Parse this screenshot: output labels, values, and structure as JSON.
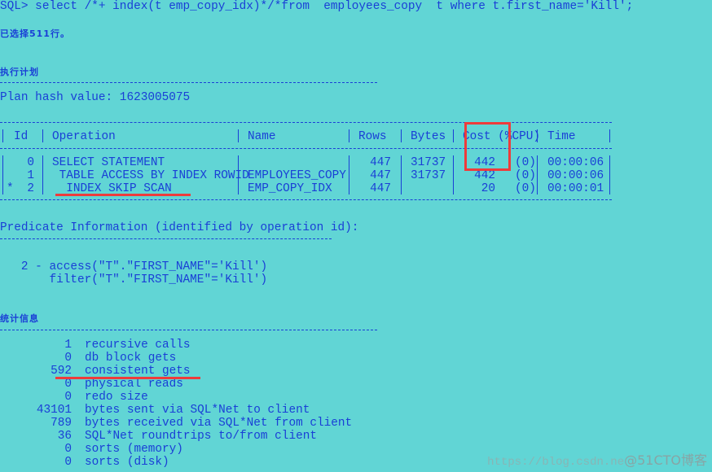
{
  "console": {
    "command_line": "SQL> select /*+ index(t emp_copy_idx)*/*from  employees_copy  t where t.first_name='Kill';",
    "rows_selected": "已选择511行。"
  },
  "execution_plan": {
    "heading": "执行计划",
    "plan_hash": "Plan hash value: 1623005075",
    "columns": [
      "Id",
      "Operation",
      "Name",
      "Rows",
      "Bytes",
      "Cost (%CPU)",
      "Time"
    ],
    "rows": [
      {
        "flag": "",
        "id": "0",
        "operation": "SELECT STATEMENT",
        "name": "",
        "rows": "447",
        "bytes": "31737",
        "cost": "442",
        "cpu": "(0)",
        "time": "00:00:06"
      },
      {
        "flag": "",
        "id": "1",
        "operation": " TABLE ACCESS BY INDEX ROWID",
        "name": "EMPLOYEES_COPY",
        "rows": "447",
        "bytes": "31737",
        "cost": "442",
        "cpu": "(0)",
        "time": "00:00:06"
      },
      {
        "flag": "*",
        "id": "2",
        "operation": "  INDEX SKIP SCAN",
        "name": "EMP_COPY_IDX",
        "rows": "447",
        "bytes": "",
        "cost": "20",
        "cpu": "(0)",
        "time": "00:00:01"
      }
    ]
  },
  "predicate": {
    "heading": "Predicate Information (identified by operation id):",
    "lines": [
      "   2 - access(\"T\".\"FIRST_NAME\"='Kill')",
      "       filter(\"T\".\"FIRST_NAME\"='Kill')"
    ]
  },
  "statistics": {
    "heading": "统计信息",
    "items": [
      {
        "value": "1",
        "label": "recursive calls"
      },
      {
        "value": "0",
        "label": "db block gets"
      },
      {
        "value": "592",
        "label": "consistent gets"
      },
      {
        "value": "0",
        "label": "physical reads"
      },
      {
        "value": "0",
        "label": "redo size"
      },
      {
        "value": "43101",
        "label": "bytes sent via SQL*Net to client"
      },
      {
        "value": "789",
        "label": "bytes received via SQL*Net from client"
      },
      {
        "value": "36",
        "label": "SQL*Net roundtrips to/from client"
      },
      {
        "value": "0",
        "label": "sorts (memory)"
      },
      {
        "value": "0",
        "label": "sorts (disk)"
      }
    ]
  },
  "annotations": {
    "highlight_color": "#ee3b3b"
  },
  "watermark": {
    "url": "https://blog.csdn.ne",
    "brand": "@51CTO博客"
  }
}
